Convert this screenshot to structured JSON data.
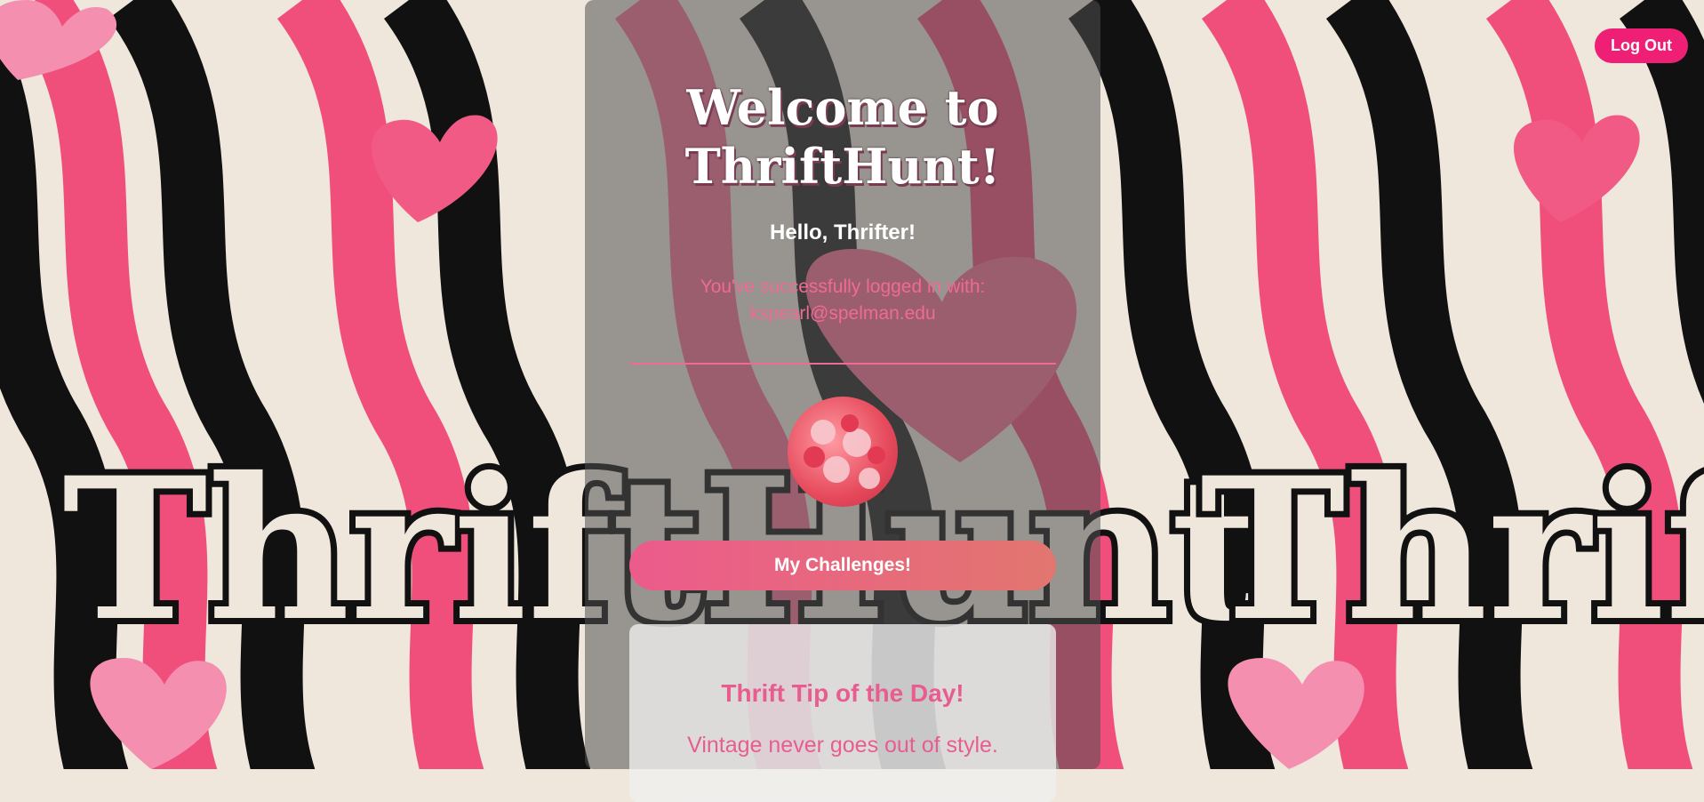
{
  "header": {
    "logout_label": "Log Out"
  },
  "background": {
    "logo_text": "ThriftHunt"
  },
  "main": {
    "title": "Welcome to ThriftHunt!",
    "greeting": "Hello, Thrifter!",
    "login_prefix": "You've successfully logged in with:",
    "email": "kspearl@spelman.edu",
    "challenges_label": "My Challenges!"
  },
  "tip": {
    "title": "Thrift Tip of the Day!",
    "text": "Vintage never goes out of style."
  },
  "colors": {
    "accent_pink": "#ee1f74",
    "button_gradient_start": "#ec5b8c",
    "button_gradient_end": "#e2766f",
    "text_pink": "#f06a96"
  },
  "icons": [
    "heart-icon",
    "profile-avatar"
  ]
}
